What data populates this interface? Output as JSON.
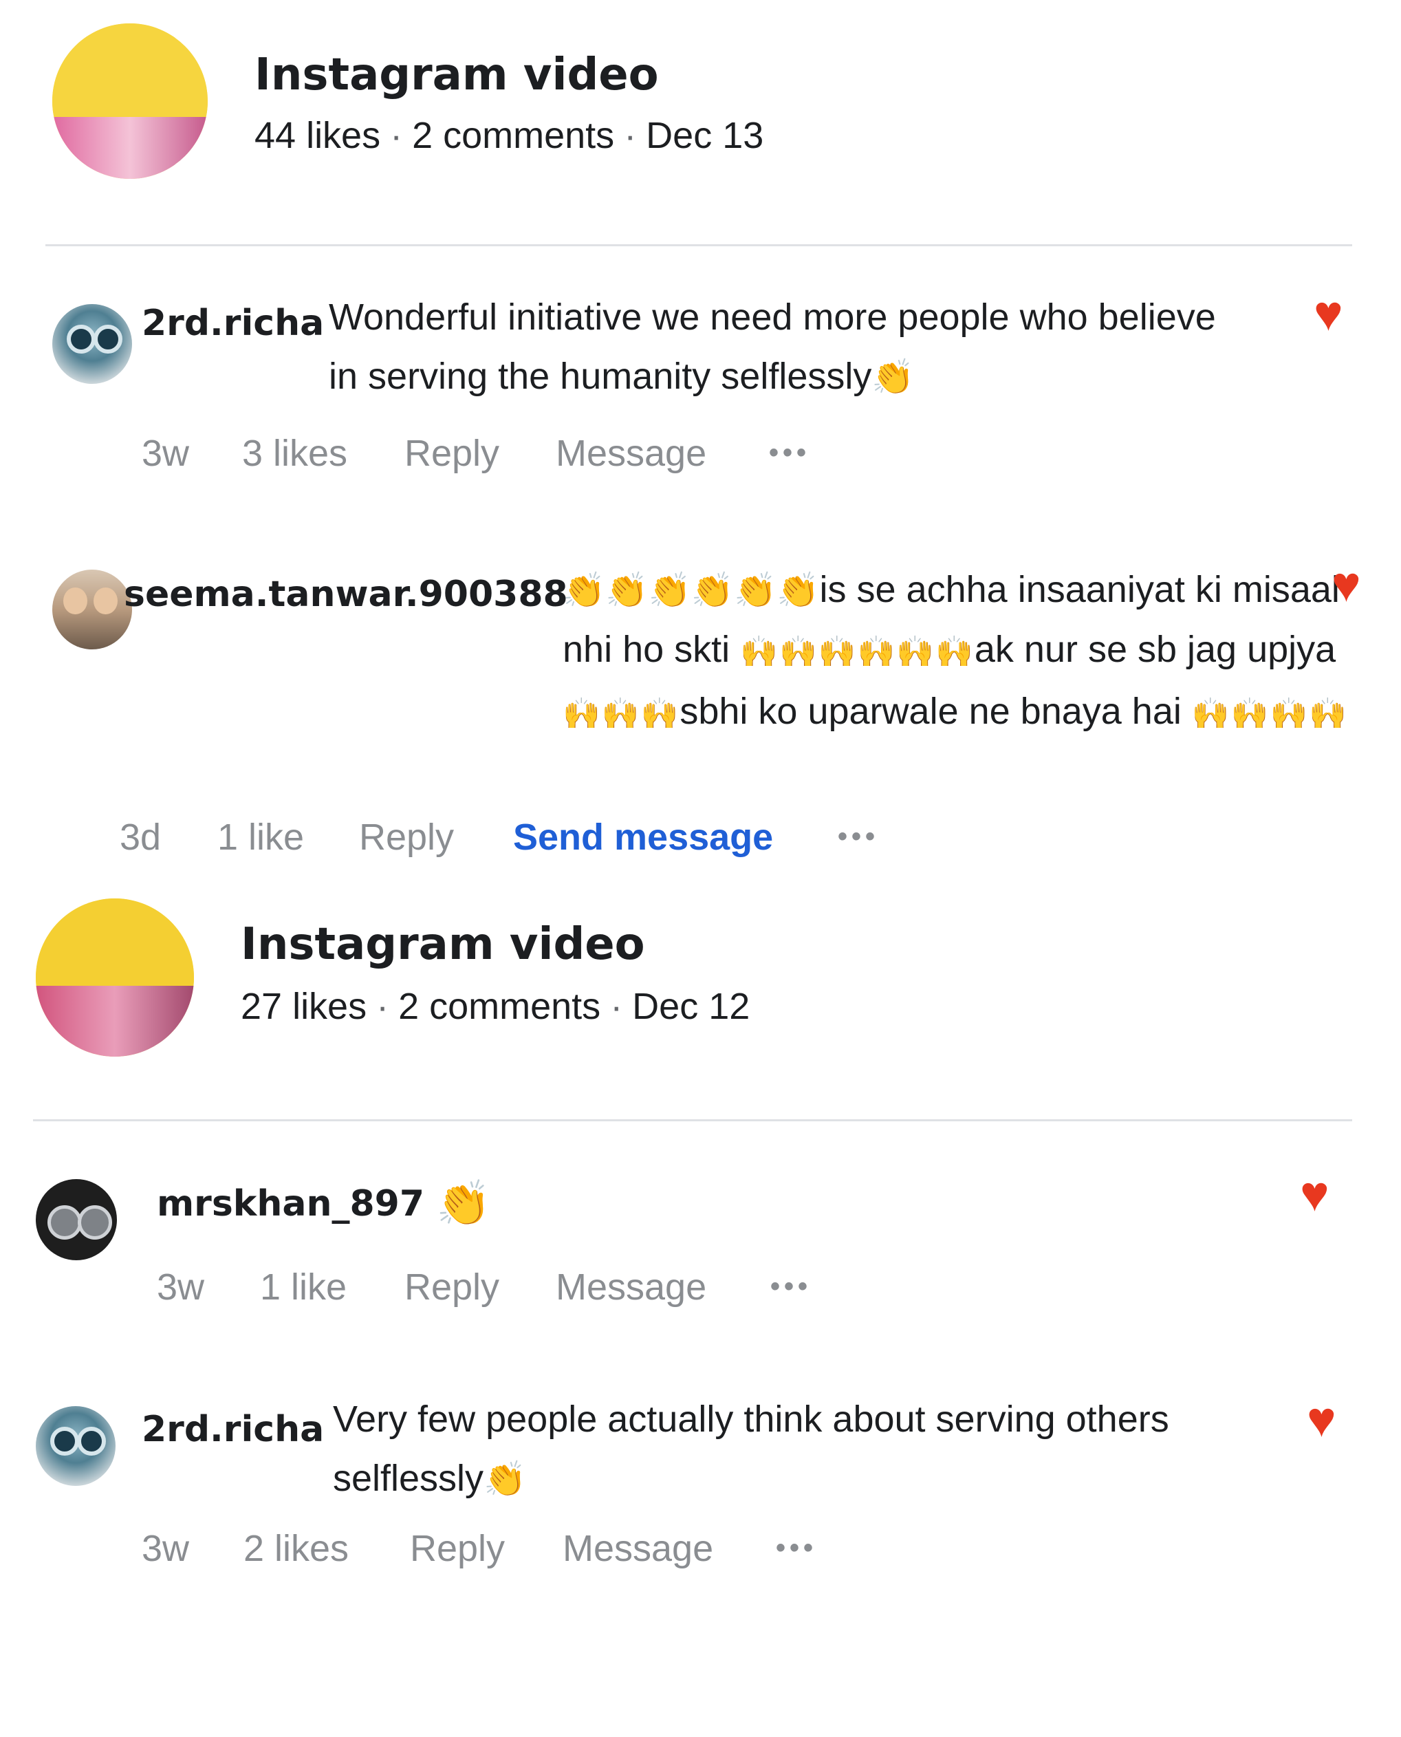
{
  "posts": [
    {
      "title": "Instagram video",
      "likes": "44 likes",
      "comments": "2 comments",
      "date": "Dec 13",
      "items": [
        {
          "username": "2rd.richa",
          "text": "Wonderful initiative we need more people who believe in serving the humanity selflessly",
          "emoji": "👏",
          "time": "3w",
          "likes": "3 likes",
          "reply": "Reply",
          "message": "Message",
          "more": "•••"
        },
        {
          "username": "seema.tanwar.900388",
          "text_1": "is se achha insaaniyat ki misaal nhi ho skti",
          "text_2": "ak nur se sb jag upjya",
          "text_3": "sbhi ko uparwale ne bnaya hai",
          "emoji_claps": "👏👏👏👏👏👏",
          "emoji_hands_a": "🙌🙌🙌🙌🙌🙌",
          "emoji_hands_b": "🙌🙌🙌",
          "emoji_hands_c": "🙌🙌🙌🙌",
          "time": "3d",
          "likes": "1 like",
          "reply": "Reply",
          "message": "Send message",
          "more": "•••"
        }
      ]
    },
    {
      "title": "Instagram video",
      "likes": "27 likes",
      "comments": "2 comments",
      "date": "Dec 12",
      "items": [
        {
          "username": "mrskhan_897",
          "emoji": "👏",
          "time": "3w",
          "likes": "1 like",
          "reply": "Reply",
          "message": "Message",
          "more": "•••"
        },
        {
          "username": "2rd.richa",
          "text": "Very few people actually think about serving others selflessly",
          "emoji": "👏",
          "time": "3w",
          "likes": "2 likes",
          "reply": "Reply",
          "message": "Message",
          "more": "•••"
        }
      ]
    }
  ],
  "separator": "·",
  "heart_icon": "♥",
  "colors": {
    "link": "#1f5fd6",
    "heart": "#e8381f",
    "muted": "#8a8d91",
    "clap": "#f2a71b"
  }
}
